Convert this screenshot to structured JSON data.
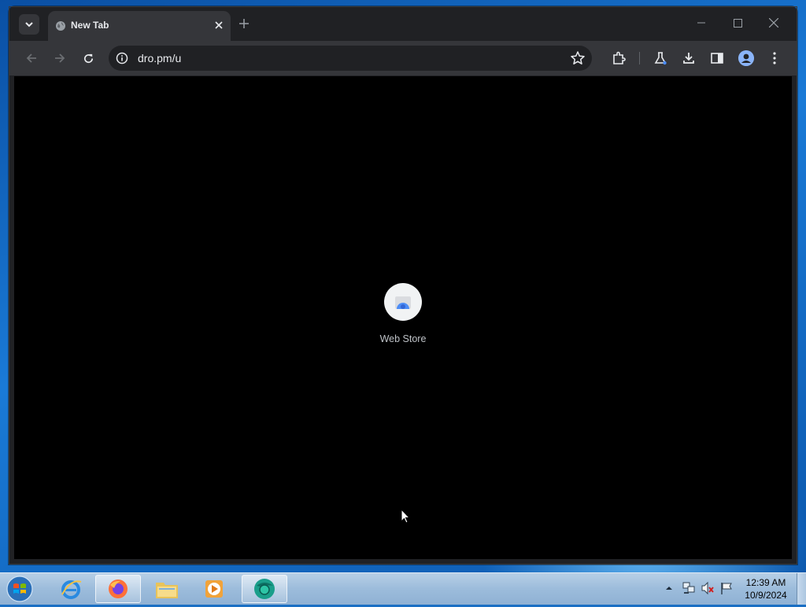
{
  "browser": {
    "tab": {
      "title": "New Tab"
    },
    "omnibox": {
      "url": "dro.pm/u"
    },
    "shortcuts": [
      {
        "label": "Web Store"
      }
    ]
  },
  "taskbar": {
    "clock": {
      "time": "12:39 AM",
      "date": "10/9/2024"
    }
  },
  "colors": {
    "page_bg": "#000000",
    "toolbar": "#35363a",
    "tabstrip": "#202124"
  }
}
